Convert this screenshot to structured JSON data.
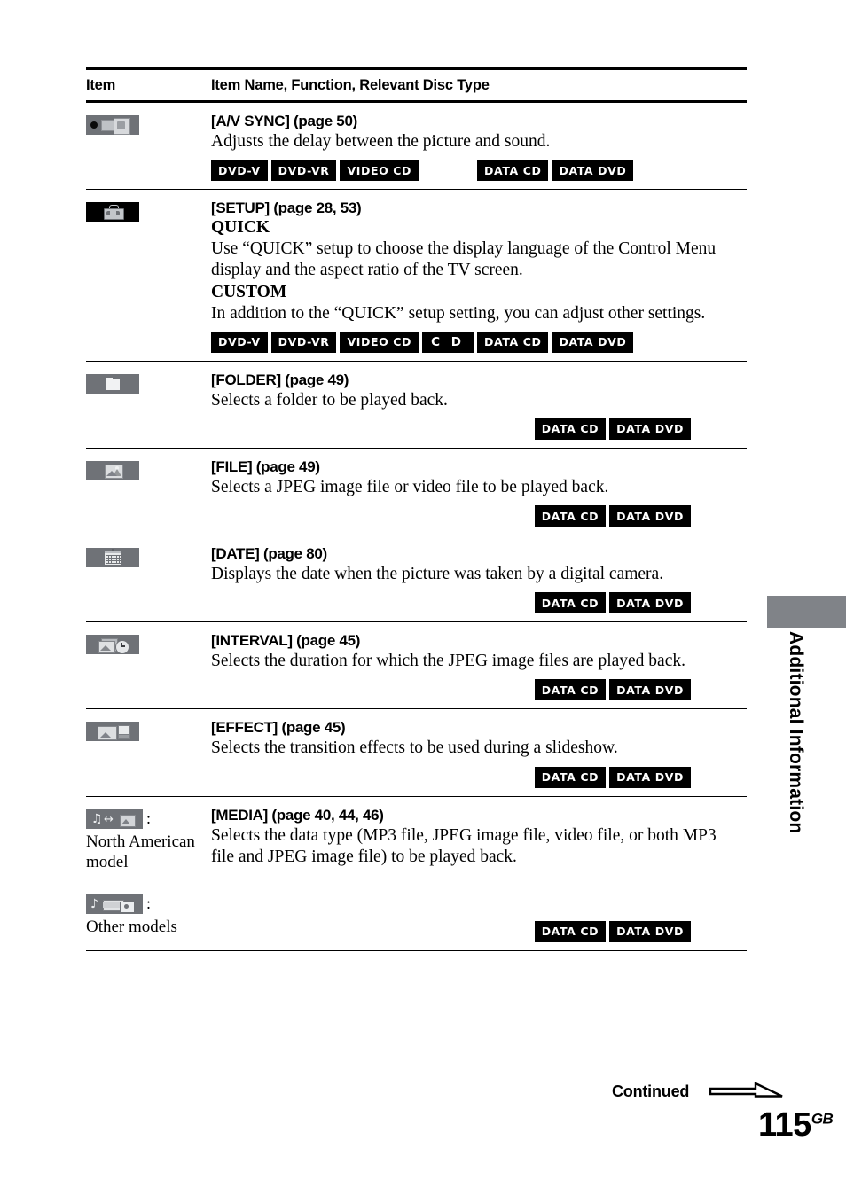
{
  "side_tab": {
    "label": "Additional Information"
  },
  "table": {
    "headers": {
      "item": "Item",
      "description": "Item Name, Function, Relevant Disc Type"
    },
    "rows": [
      {
        "icon_name": "av-sync-icon",
        "title": "[A/V SYNC] (page 50)",
        "desc": "Adjusts the delay between the picture and sound.",
        "badges": [
          "DVD-V",
          "DVD-VR",
          "VIDEO CD",
          "",
          "DATA CD",
          "DATA DVD"
        ],
        "badge_align": "left"
      },
      {
        "icon_name": "setup-toolbox-icon",
        "title": "[SETUP] (page 28, 53)",
        "subhead1": "QUICK",
        "desc1": "Use “QUICK” setup to choose the display language of the Control Menu display and the aspect ratio of the TV screen.",
        "subhead2": "CUSTOM",
        "desc2": "In addition to the “QUICK” setup setting, you can adjust other settings.",
        "badges": [
          "DVD-V",
          "DVD-VR",
          "VIDEO CD",
          "C D",
          "DATA CD",
          "DATA DVD"
        ],
        "badge_align": "left"
      },
      {
        "icon_name": "folder-icon",
        "title": "[FOLDER] (page 49)",
        "desc": "Selects a folder to be played back.",
        "badges": [
          "DATA CD",
          "DATA DVD"
        ],
        "badge_align": "right"
      },
      {
        "icon_name": "file-picture-icon",
        "title": "[FILE] (page 49)",
        "desc": "Selects a JPEG image file or video file to be played back.",
        "badges": [
          "DATA CD",
          "DATA DVD"
        ],
        "badge_align": "right"
      },
      {
        "icon_name": "calendar-date-icon",
        "title": "[DATE] (page 80)",
        "desc": "Displays the date when the picture was taken by a digital camera.",
        "badges": [
          "DATA CD",
          "DATA DVD"
        ],
        "badge_align": "right"
      },
      {
        "icon_name": "interval-clock-icon",
        "title": "[INTERVAL] (page 45)",
        "desc": "Selects the duration for which the JPEG image files are played back.",
        "badges": [
          "DATA CD",
          "DATA DVD"
        ],
        "badge_align": "right"
      },
      {
        "icon_name": "effect-slideshow-icon",
        "title": "[EFFECT] (page 45)",
        "desc": "Selects the transition effects to be used during a slideshow.",
        "badges": [
          "DATA CD",
          "DATA DVD"
        ],
        "badge_align": "right"
      },
      {
        "icon_name": "media-icon",
        "title": "[MEDIA] (page 40, 44, 46)",
        "desc": "Selects the data type (MP3 file, JPEG image file, video file, or both MP3 file and JPEG image file) to be played back.",
        "badges": [
          "DATA CD",
          "DATA DVD"
        ],
        "badge_align": "right",
        "icon_caption_1": ":",
        "icon_model_1": "North American model",
        "icon_caption_2": ":",
        "icon_model_2": "Other models"
      }
    ]
  },
  "footer": {
    "continued": "Continued",
    "page_number": "115",
    "page_suffix": "GB"
  }
}
